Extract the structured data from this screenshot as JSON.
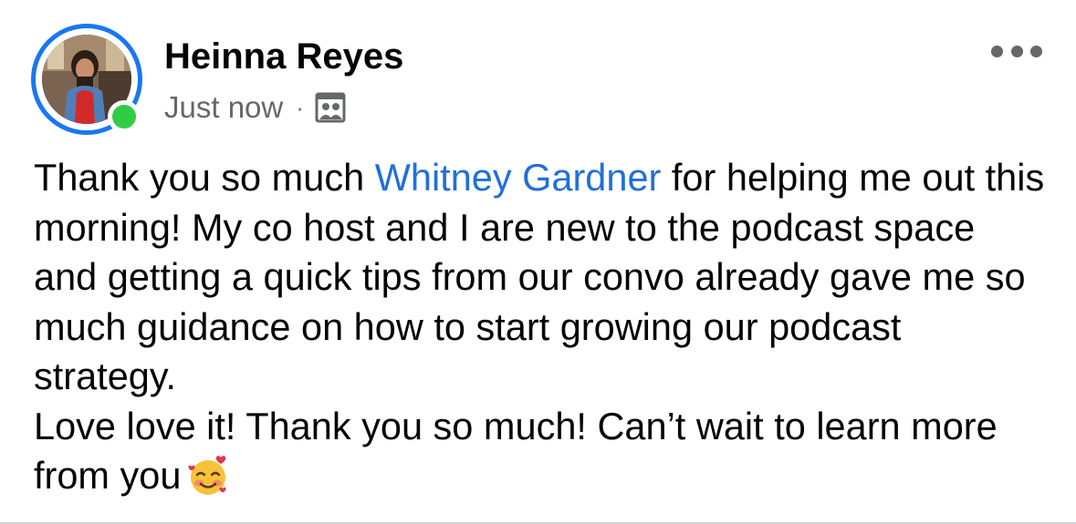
{
  "post": {
    "author": {
      "name": "Heinna Reyes",
      "online": true,
      "avatar_icon": "profile-photo"
    },
    "timestamp": "Just now",
    "separator": "·",
    "audience_icon": "friends-audience-icon",
    "more_icon": "more-options-icon",
    "body": {
      "line1_pre": "Thank you so much ",
      "mention": "Whitney Gardner",
      "line1_post": " for helping me out this morning! My co host and I are new to the podcast space and getting a quick tips from our convo already gave me so much guidance on how to start growing our podcast strategy.",
      "line2": "Love love it! Thank you so much! Can’t wait to learn more from you",
      "emoji_icon": "smiling-face-with-hearts"
    },
    "colors": {
      "accent": "#1877f2",
      "mention": "#216fdb",
      "online": "#31cc46",
      "secondary_text": "#65676b"
    }
  }
}
